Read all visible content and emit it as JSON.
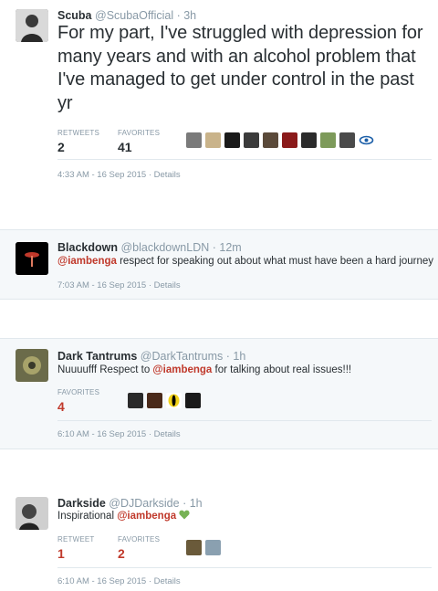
{
  "tweets": [
    {
      "name": "Scuba",
      "handle": "@ScubaOfficial",
      "time": "· 3h",
      "text": "For my part, I've struggled with depression for many years and with an alcohol problem that I've managed to get under control in the past yr",
      "retweets_label": "RETWEETS",
      "retweets": "2",
      "favorites_label": "FAVORITES",
      "favorites": "41",
      "meta": "4:33 AM - 16 Sep 2015 · Details"
    },
    {
      "name": "Blackdown",
      "handle": "@blackdownLDN",
      "time": "· 12m",
      "mention": "@iambenga",
      "text": " respect for speaking out about what must have been a hard journey",
      "meta": "7:03 AM - 16 Sep 2015 · Details"
    },
    {
      "name": "Dark Tantrums",
      "handle": "@DarkTantrums",
      "time": "· 1h",
      "text_before": "Nuuuufff Respect to ",
      "mention": "@iambenga",
      "text_after": " for talking about real issues!!!",
      "favorites_label": "FAVORITES",
      "favorites": "4",
      "meta": "6:10 AM - 16 Sep 2015 · Details"
    },
    {
      "name": "Darkside",
      "handle": "@DJDarkside",
      "time": "· 1h",
      "text_before": "Inspirational ",
      "mention": "@iambenga",
      "retweets_label": "RETWEET",
      "retweets": "1",
      "favorites_label": "FAVORITES",
      "favorites": "2",
      "meta": "6:10 AM - 16 Sep 2015 · Details"
    }
  ],
  "colors": {
    "text": "#292f33",
    "muted": "#8899a6",
    "mention": "#c0392b",
    "heart": "#77b255"
  }
}
